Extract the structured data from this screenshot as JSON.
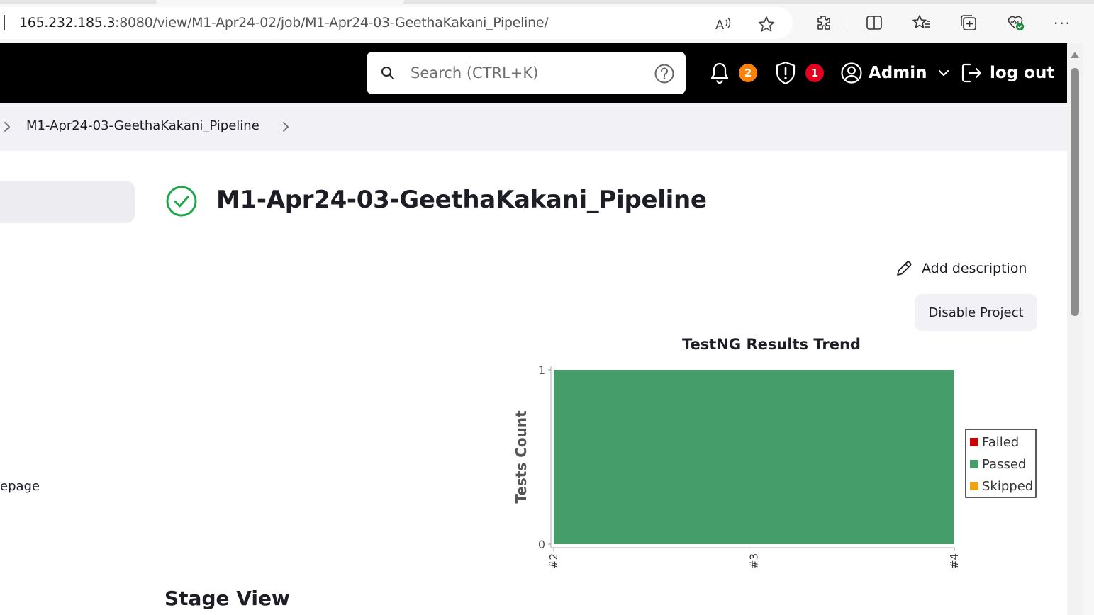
{
  "browser": {
    "url_host": "165.232.185.3",
    "url_path": ":8080/view/M1-Apr24-02/job/M1-Apr24-03-GeethaKakani_Pipeline/",
    "read_aloud_icon": "read-aloud-icon",
    "favorite_icon": "star-icon"
  },
  "header": {
    "search_placeholder": "Search (CTRL+K)",
    "notifications_count": "2",
    "security_count": "1",
    "user_name": "Admin",
    "logout_label": "log out"
  },
  "breadcrumb": {
    "items": [
      "M1-Apr24-03-GeethaKakani_Pipeline"
    ]
  },
  "sidebar": {
    "partial_link": "epage"
  },
  "main": {
    "title": "M1-Apr24-03-GeethaKakani_Pipeline",
    "status": "success",
    "add_description": "Add description",
    "disable_project": "Disable Project",
    "stage_view_title": "Stage View"
  },
  "colors": {
    "passed": "#459e6a",
    "failed": "#cc0000",
    "skipped": "#f0a30a",
    "success_icon": "#1ea64b",
    "badge_orange": "#fe820a",
    "badge_red": "#e6001f"
  },
  "chart_data": {
    "type": "area",
    "title": "TestNG Results Trend",
    "xlabel": "",
    "ylabel": "Tests Count",
    "categories": [
      "#2",
      "#3",
      "#4"
    ],
    "ylim": [
      0,
      1
    ],
    "yticks": [
      "0",
      "1"
    ],
    "series": [
      {
        "name": "Failed",
        "values": [
          0,
          0,
          0
        ],
        "color": "#cc0000"
      },
      {
        "name": "Passed",
        "values": [
          1,
          1,
          1
        ],
        "color": "#459e6a"
      },
      {
        "name": "Skipped",
        "values": [
          0,
          0,
          0
        ],
        "color": "#f0a30a"
      }
    ],
    "legend_position": "right"
  }
}
